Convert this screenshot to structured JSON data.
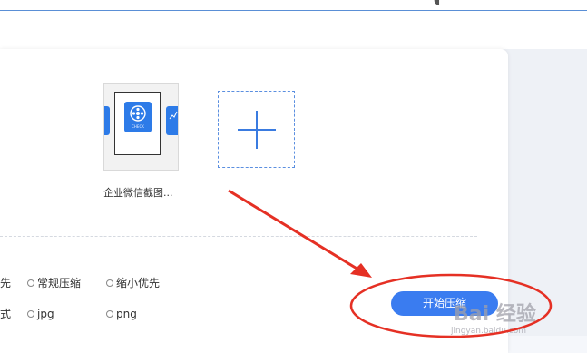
{
  "file": {
    "name": "企业微信截图...",
    "icon_caption": "CHECK"
  },
  "add_button": {
    "icon": "plus-icon"
  },
  "options": {
    "row1": {
      "partial_label": "先",
      "choice1": "常规压缩",
      "choice2": "缩小优先"
    },
    "row2": {
      "partial_label": "式",
      "choice1": "jpg",
      "choice2": "png"
    }
  },
  "actions": {
    "start_label": "开始压缩"
  },
  "watermark": {
    "brand": "Bai  经验",
    "sub": "jingyan.baidu.com"
  },
  "colors": {
    "accent": "#3a7cf0",
    "annotation": "#e53024"
  }
}
